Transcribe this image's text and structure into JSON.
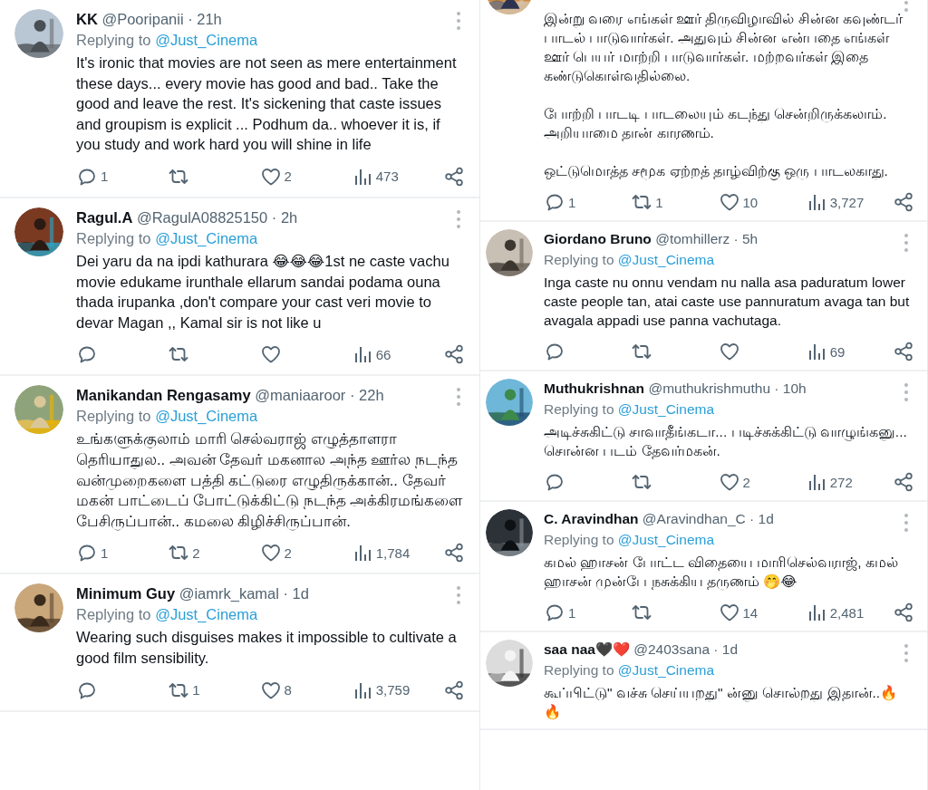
{
  "columns": [
    {
      "tweets": [
        {
          "kind": "full",
          "name": "KK",
          "handle": "@Pooripanii",
          "time": "· 21h",
          "replying_label": "Replying to",
          "replying_to": "@Just_Cinema",
          "body": "It's ironic that movies are not seen as mere entertainment these days... every movie has good and bad.. Take the good and leave the rest. It's sickening that caste issues and groupism is explicit ... Podhum da.. whoever it is, if you study and work hard you will shine in life",
          "actions": [
            {
              "kind": "reply",
              "count": "1"
            },
            {
              "kind": "retweet"
            },
            {
              "kind": "like",
              "count": "2"
            },
            {
              "kind": "views",
              "count": "473"
            },
            {
              "kind": "share"
            }
          ]
        },
        {
          "kind": "full",
          "name": "Ragul.A",
          "handle": "@RagulA08825150",
          "time": "· 2h",
          "replying_label": "Replying to",
          "replying_to": "@Just_Cinema",
          "body": "Dei yaru da na ipdi kathurara 😂😂😂1st ne caste vachu movie edukame irunthale ellarum sandai podama ouna thada irupanka ,don't compare your cast veri movie to devar Magan ,, Kamal sir is not like u",
          "actions": [
            {
              "kind": "reply"
            },
            {
              "kind": "retweet"
            },
            {
              "kind": "like"
            },
            {
              "kind": "views",
              "count": "66"
            },
            {
              "kind": "share"
            }
          ]
        },
        {
          "kind": "full",
          "name": "Manikandan Rengasamy",
          "handle": "@maniaaroor",
          "time": "· 22h",
          "replying_label": "Replying to",
          "replying_to": "@Just_Cinema",
          "body": "உங்களுக்குலாம் மாரி செல்வராஜ் எழுத்தாளரா தெரியாதுல.. அவன் தேவர் மகனால அந்த ஊர்ல நடந்த வன்முறைகளை பத்தி கட்டுரை எழுதிருக்கான்.. தேவர் மகன் பாட்டைப் போட்டுக்கிட்டு நடந்த அக்கிரமங்களை பேசிருப்பான்.. கமலை கிழிச்சிருப்பான்.",
          "actions": [
            {
              "kind": "reply",
              "count": "1"
            },
            {
              "kind": "retweet",
              "count": "2"
            },
            {
              "kind": "like",
              "count": "2"
            },
            {
              "kind": "views",
              "count": "1,784"
            },
            {
              "kind": "share"
            }
          ]
        },
        {
          "kind": "full",
          "name": "Minimum Guy",
          "handle": "@iamrk_kamal",
          "time": "· 1d",
          "replying_label": "Replying to",
          "replying_to": "@Just_Cinema",
          "body": "Wearing such disguises makes it impossible to cultivate a good film sensibility.",
          "actions": [
            {
              "kind": "reply"
            },
            {
              "kind": "retweet",
              "count": "1"
            },
            {
              "kind": "like",
              "count": "8"
            },
            {
              "kind": "views",
              "count": "3,759"
            },
            {
              "kind": "share"
            }
          ]
        }
      ]
    },
    {
      "tweets": [
        {
          "kind": "partial",
          "body": "இன்று வரை எங்கள் ஊர் திருவிழாவில் சின்ன கவுண்டர் பாடல் பாடுவார்கள். அதுவும் சின்ன என்பதை எங்கள் ஊர் பெயர் மாற்றி பாடுவார்கள். மற்றவர்கள் இதை கண்டுகொள்வதில்லை.\n\nபோற்றி பாடடி பாடலையும் கடந்து சென்றிருக்கலாம். அறியாமை தான் காரணம்.\n\nஒட்டுமொத்த சமூக ஏற்றத் தாழ்விற்கு ஒரு பாடலகாது.",
          "actions": [
            {
              "kind": "reply",
              "count": "1"
            },
            {
              "kind": "retweet",
              "count": "1"
            },
            {
              "kind": "like",
              "count": "10"
            },
            {
              "kind": "views",
              "count": "3,727"
            },
            {
              "kind": "share"
            }
          ]
        },
        {
          "kind": "full",
          "name": "Giordano Bruno",
          "handle": "@tomhillerz",
          "time": "· 5h",
          "replying_label": "Replying to",
          "replying_to": "@Just_Cinema",
          "body": "Inga caste nu onnu vendam nu nalla asa paduratum lower caste people tan, atai caste use pannuratum avaga tan but avagala appadi use panna vachutaga.",
          "actions": [
            {
              "kind": "reply"
            },
            {
              "kind": "retweet"
            },
            {
              "kind": "like"
            },
            {
              "kind": "views",
              "count": "69"
            },
            {
              "kind": "share"
            }
          ]
        },
        {
          "kind": "full",
          "name": "Muthukrishnan",
          "handle": "@muthukrishmuthu",
          "time": "· 10h",
          "replying_label": "Replying to",
          "replying_to": "@Just_Cinema",
          "body": "அடிச்சுகிட்டு சாவாதீங்கடா... படிச்சுக்கிட்டு வாழுங்கனு... சொன்ன படம் தேவர்மகன்.",
          "actions": [
            {
              "kind": "reply"
            },
            {
              "kind": "retweet"
            },
            {
              "kind": "like",
              "count": "2"
            },
            {
              "kind": "views",
              "count": "272"
            },
            {
              "kind": "share"
            }
          ]
        },
        {
          "kind": "full",
          "name": "C. Aravindhan",
          "handle": "@Aravindhan_C",
          "time": "· 1d",
          "replying_label": "Replying to",
          "replying_to": "@Just_Cinema",
          "body": "கமல் ஹாசன் போட்ட விதையை மாரிசெல்வராஜ், கமல் ஹாசன் முன்பே நசுக்கிய தருணம் 🤭😂",
          "actions": [
            {
              "kind": "reply",
              "count": "1"
            },
            {
              "kind": "retweet"
            },
            {
              "kind": "like",
              "count": "14"
            },
            {
              "kind": "views",
              "count": "2,481"
            },
            {
              "kind": "share"
            }
          ]
        },
        {
          "kind": "full",
          "name": "saa naa🖤❤️",
          "handle": "@2403sana",
          "time": "· 1d",
          "replying_label": "Replying to",
          "replying_to": "@Just_Cinema",
          "body": "கூப்பிட்டு\" வச்சு செய்யறது\" ன்னு சொல்றது இதான்..🔥🔥"
        }
      ]
    }
  ]
}
